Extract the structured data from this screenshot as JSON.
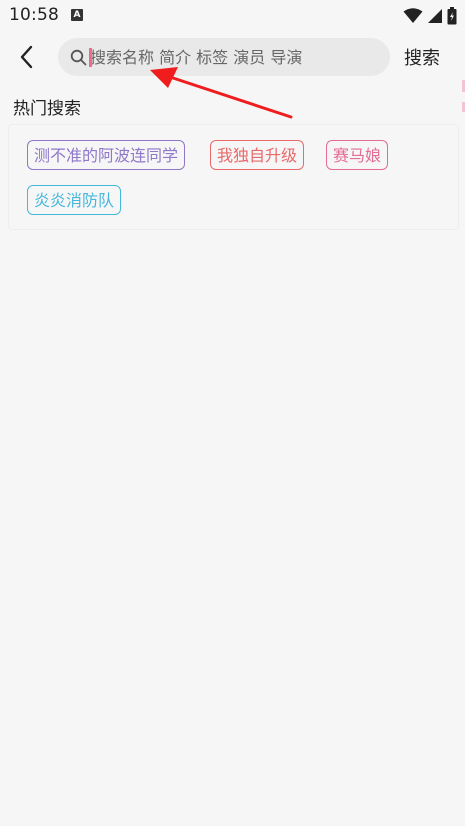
{
  "status_bar": {
    "time": "10:58",
    "notification_icon": "A"
  },
  "header": {
    "back_icon": "chevron-left-icon",
    "search": {
      "placeholder": "搜索名称 简介 标签 演员 导演",
      "value": ""
    },
    "search_button_label": "搜索"
  },
  "hot_search": {
    "title": "热门搜索",
    "tags": [
      {
        "label": "测不准的阿波连同学",
        "color": "#8f77c9"
      },
      {
        "label": "我独自升级",
        "color": "#e86a6a"
      },
      {
        "label": "赛马娘",
        "color": "#e46c96"
      },
      {
        "label": "炎炎消防队",
        "color": "#45b8de"
      }
    ]
  },
  "annotation": {
    "arrow_color": "#ef1d1d"
  }
}
